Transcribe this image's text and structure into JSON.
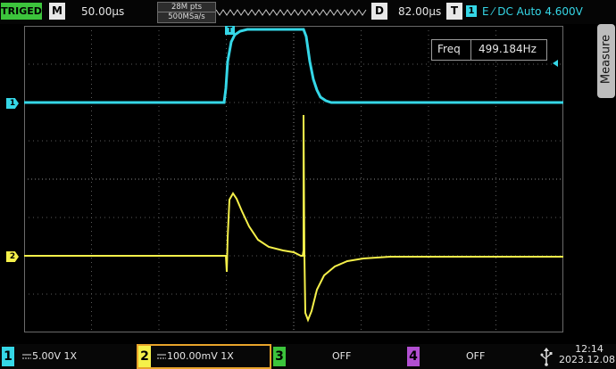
{
  "trigger_status": "TRIGED",
  "menu_button": "M",
  "timebase": "50.00µs",
  "memory_depth": "28M pts",
  "sample_rate": "500MSa/s",
  "delay_button": "D",
  "delay_value": "82.00µs",
  "trigger_button": "T",
  "trigger_channel": "1",
  "trigger_settings": "E ⁄ DC Auto 4.600V",
  "freq_label": "Freq",
  "freq_value": "499.184Hz",
  "measure_label": "Measure",
  "ch1_marker": "1",
  "ch2_marker": "2",
  "trigger_marker": "T",
  "colors": {
    "ch1": "#35d7e7",
    "ch2": "#f5f04a",
    "ch3": "#3cc43c",
    "ch4": "#b24fd1",
    "grid": "#5a5a5a"
  },
  "channels": [
    {
      "num": "1",
      "value": "5.00V 1X"
    },
    {
      "num": "2",
      "value": "100.00mV 1X"
    },
    {
      "num": "3",
      "value": "OFF"
    },
    {
      "num": "4",
      "value": "OFF"
    }
  ],
  "clock": {
    "time": "12:14",
    "date": "2023.12.08"
  }
}
